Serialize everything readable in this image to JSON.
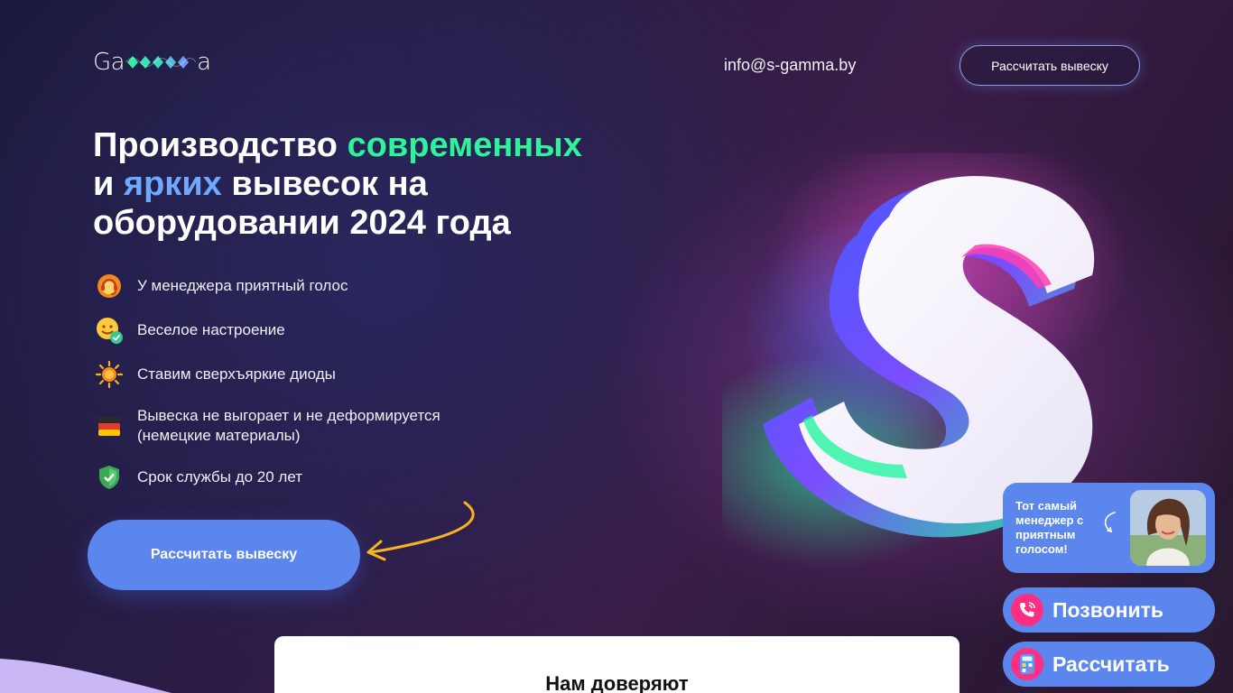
{
  "header": {
    "logo": {
      "prefix": "Ga",
      "suffix": "a",
      "word": "Gamma"
    },
    "email": "info@s-gamma.by",
    "cta_label": "Рассчитать вывеску"
  },
  "hero": {
    "headline": {
      "part1": "Производство ",
      "accent1": "современных",
      "part2": "и ",
      "accent2": "ярких",
      "part3": " вывесок на",
      "part4": "оборудовании 2024 года"
    },
    "features": [
      {
        "icon": "headset-icon",
        "text": "У менеджера приятный голос"
      },
      {
        "icon": "smiley-check-icon",
        "text": "Веселое настроение"
      },
      {
        "icon": "sun-icon",
        "text": "Ставим сверхъяркие диоды"
      },
      {
        "icon": "germany-flag-icon",
        "text": "Вывеска не выгорает и не деформируется",
        "text2": "(немецкие материалы)"
      },
      {
        "icon": "shield-check-icon",
        "text": "Срок службы до 20 лет"
      }
    ],
    "cta_label": "Рассчитать вывеску"
  },
  "trust": {
    "title": "Нам доверяют"
  },
  "widget": {
    "manager_text": "Тот самый менеджер с приятным голосом!",
    "call_label": "Позвонить",
    "calc_label": "Рассчитать"
  },
  "colors": {
    "accent_blue": "#5b86ee",
    "headline_green": "#2ef39a",
    "headline_blue": "#6fa9ff"
  }
}
